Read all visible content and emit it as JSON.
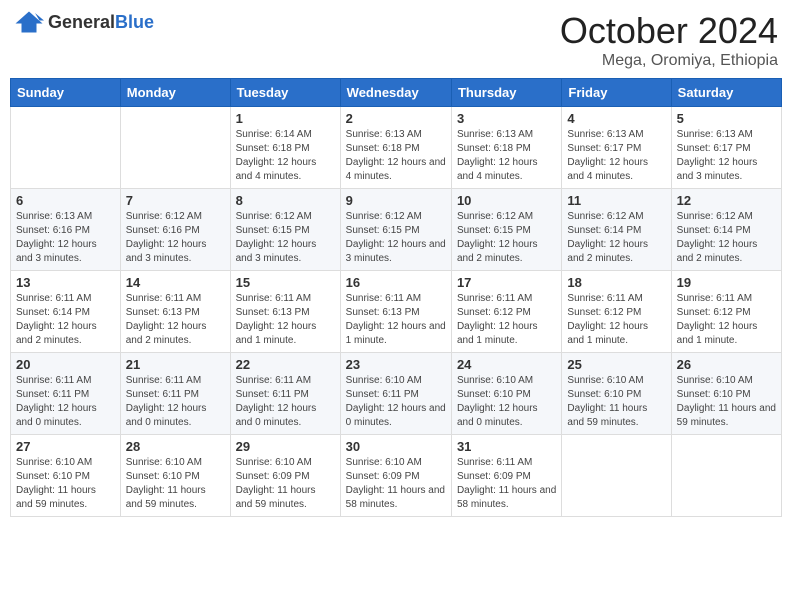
{
  "header": {
    "logo_general": "General",
    "logo_blue": "Blue",
    "month": "October 2024",
    "location": "Mega, Oromiya, Ethiopia"
  },
  "weekdays": [
    "Sunday",
    "Monday",
    "Tuesday",
    "Wednesday",
    "Thursday",
    "Friday",
    "Saturday"
  ],
  "weeks": [
    [
      {
        "day": "",
        "info": ""
      },
      {
        "day": "",
        "info": ""
      },
      {
        "day": "1",
        "info": "Sunrise: 6:14 AM\nSunset: 6:18 PM\nDaylight: 12 hours and 4 minutes."
      },
      {
        "day": "2",
        "info": "Sunrise: 6:13 AM\nSunset: 6:18 PM\nDaylight: 12 hours and 4 minutes."
      },
      {
        "day": "3",
        "info": "Sunrise: 6:13 AM\nSunset: 6:18 PM\nDaylight: 12 hours and 4 minutes."
      },
      {
        "day": "4",
        "info": "Sunrise: 6:13 AM\nSunset: 6:17 PM\nDaylight: 12 hours and 4 minutes."
      },
      {
        "day": "5",
        "info": "Sunrise: 6:13 AM\nSunset: 6:17 PM\nDaylight: 12 hours and 3 minutes."
      }
    ],
    [
      {
        "day": "6",
        "info": "Sunrise: 6:13 AM\nSunset: 6:16 PM\nDaylight: 12 hours and 3 minutes."
      },
      {
        "day": "7",
        "info": "Sunrise: 6:12 AM\nSunset: 6:16 PM\nDaylight: 12 hours and 3 minutes."
      },
      {
        "day": "8",
        "info": "Sunrise: 6:12 AM\nSunset: 6:15 PM\nDaylight: 12 hours and 3 minutes."
      },
      {
        "day": "9",
        "info": "Sunrise: 6:12 AM\nSunset: 6:15 PM\nDaylight: 12 hours and 3 minutes."
      },
      {
        "day": "10",
        "info": "Sunrise: 6:12 AM\nSunset: 6:15 PM\nDaylight: 12 hours and 2 minutes."
      },
      {
        "day": "11",
        "info": "Sunrise: 6:12 AM\nSunset: 6:14 PM\nDaylight: 12 hours and 2 minutes."
      },
      {
        "day": "12",
        "info": "Sunrise: 6:12 AM\nSunset: 6:14 PM\nDaylight: 12 hours and 2 minutes."
      }
    ],
    [
      {
        "day": "13",
        "info": "Sunrise: 6:11 AM\nSunset: 6:14 PM\nDaylight: 12 hours and 2 minutes."
      },
      {
        "day": "14",
        "info": "Sunrise: 6:11 AM\nSunset: 6:13 PM\nDaylight: 12 hours and 2 minutes."
      },
      {
        "day": "15",
        "info": "Sunrise: 6:11 AM\nSunset: 6:13 PM\nDaylight: 12 hours and 1 minute."
      },
      {
        "day": "16",
        "info": "Sunrise: 6:11 AM\nSunset: 6:13 PM\nDaylight: 12 hours and 1 minute."
      },
      {
        "day": "17",
        "info": "Sunrise: 6:11 AM\nSunset: 6:12 PM\nDaylight: 12 hours and 1 minute."
      },
      {
        "day": "18",
        "info": "Sunrise: 6:11 AM\nSunset: 6:12 PM\nDaylight: 12 hours and 1 minute."
      },
      {
        "day": "19",
        "info": "Sunrise: 6:11 AM\nSunset: 6:12 PM\nDaylight: 12 hours and 1 minute."
      }
    ],
    [
      {
        "day": "20",
        "info": "Sunrise: 6:11 AM\nSunset: 6:11 PM\nDaylight: 12 hours and 0 minutes."
      },
      {
        "day": "21",
        "info": "Sunrise: 6:11 AM\nSunset: 6:11 PM\nDaylight: 12 hours and 0 minutes."
      },
      {
        "day": "22",
        "info": "Sunrise: 6:11 AM\nSunset: 6:11 PM\nDaylight: 12 hours and 0 minutes."
      },
      {
        "day": "23",
        "info": "Sunrise: 6:10 AM\nSunset: 6:11 PM\nDaylight: 12 hours and 0 minutes."
      },
      {
        "day": "24",
        "info": "Sunrise: 6:10 AM\nSunset: 6:10 PM\nDaylight: 12 hours and 0 minutes."
      },
      {
        "day": "25",
        "info": "Sunrise: 6:10 AM\nSunset: 6:10 PM\nDaylight: 11 hours and 59 minutes."
      },
      {
        "day": "26",
        "info": "Sunrise: 6:10 AM\nSunset: 6:10 PM\nDaylight: 11 hours and 59 minutes."
      }
    ],
    [
      {
        "day": "27",
        "info": "Sunrise: 6:10 AM\nSunset: 6:10 PM\nDaylight: 11 hours and 59 minutes."
      },
      {
        "day": "28",
        "info": "Sunrise: 6:10 AM\nSunset: 6:10 PM\nDaylight: 11 hours and 59 minutes."
      },
      {
        "day": "29",
        "info": "Sunrise: 6:10 AM\nSunset: 6:09 PM\nDaylight: 11 hours and 59 minutes."
      },
      {
        "day": "30",
        "info": "Sunrise: 6:10 AM\nSunset: 6:09 PM\nDaylight: 11 hours and 58 minutes."
      },
      {
        "day": "31",
        "info": "Sunrise: 6:11 AM\nSunset: 6:09 PM\nDaylight: 11 hours and 58 minutes."
      },
      {
        "day": "",
        "info": ""
      },
      {
        "day": "",
        "info": ""
      }
    ]
  ]
}
